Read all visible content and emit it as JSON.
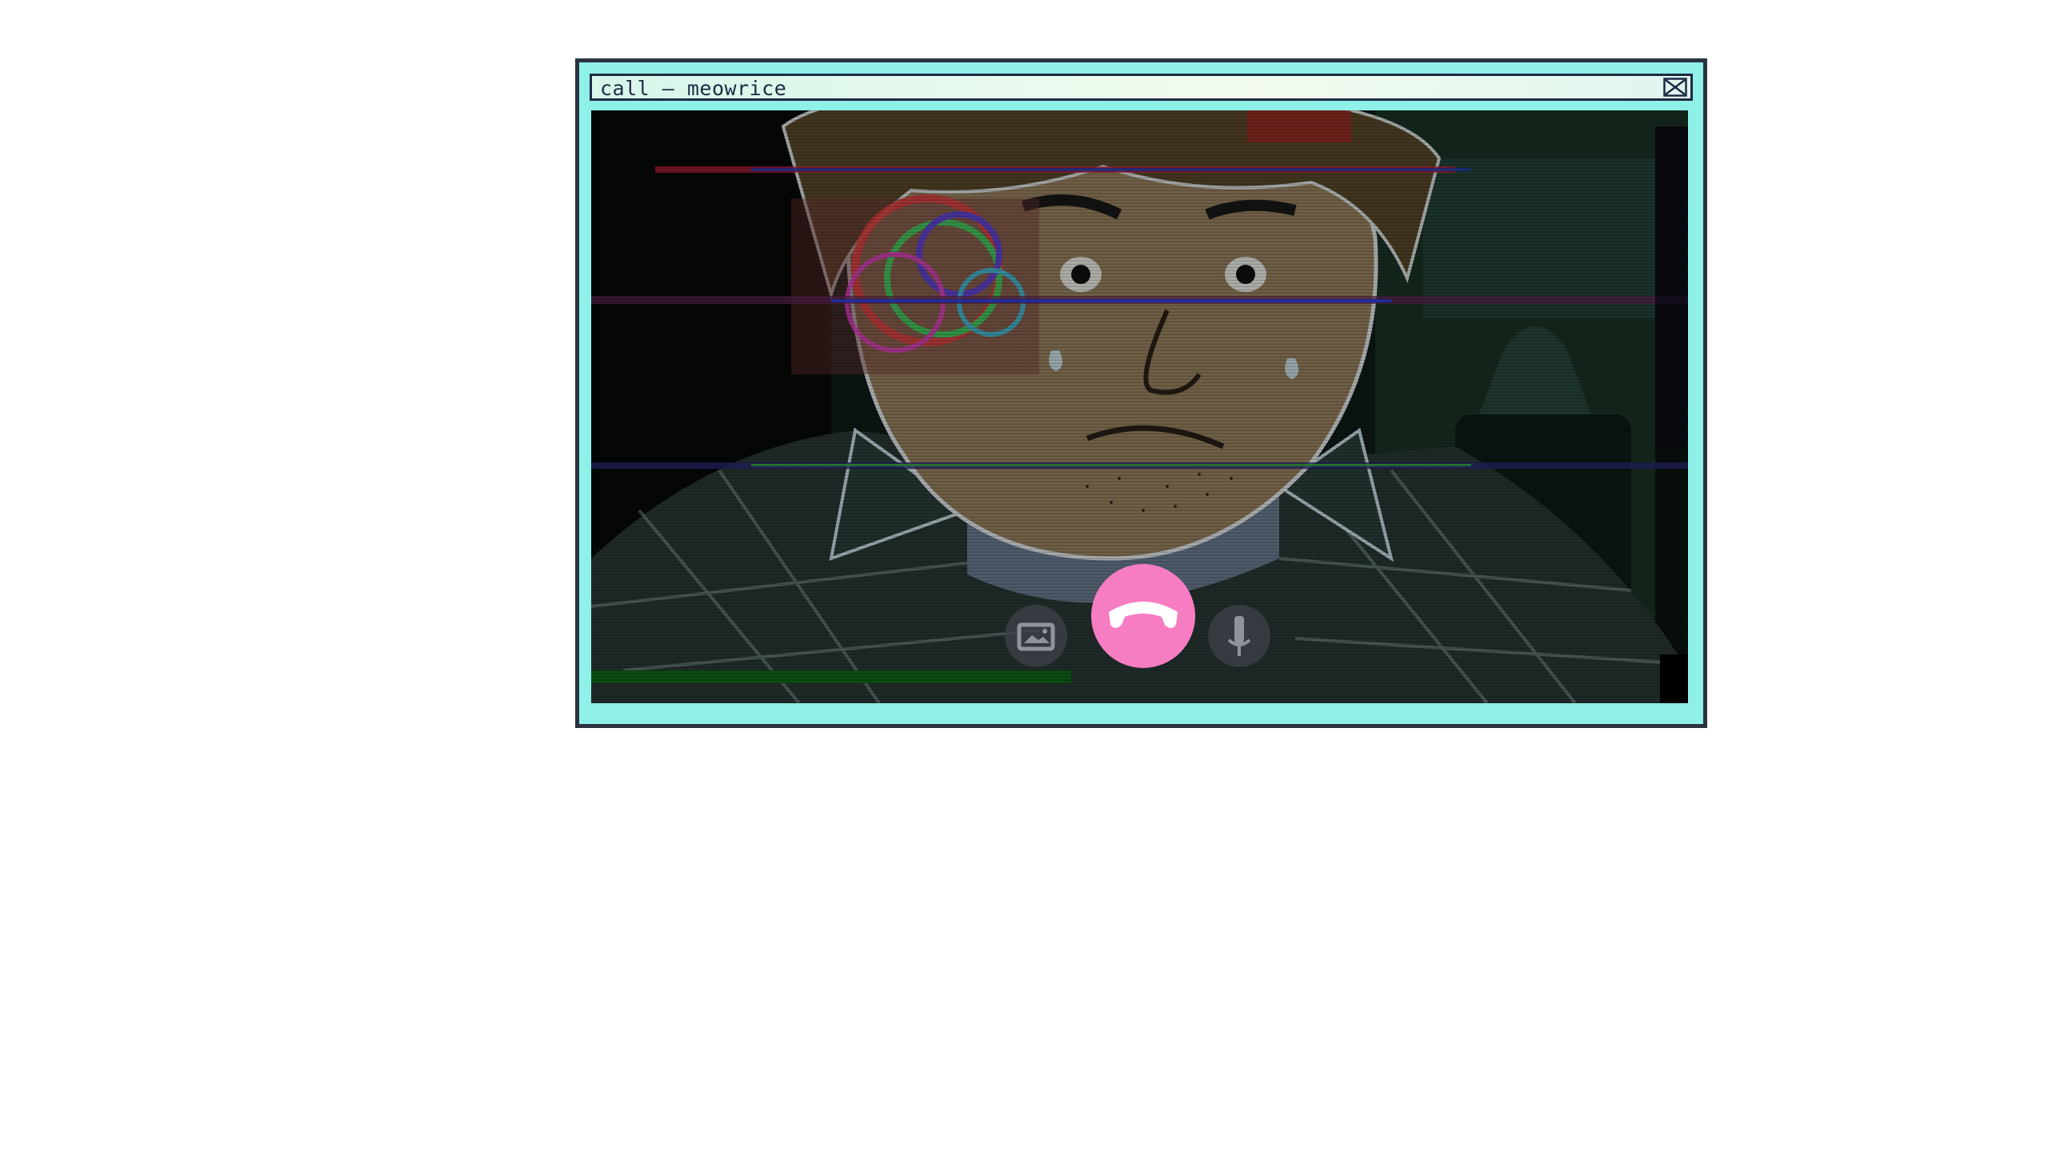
{
  "window": {
    "title": "call – meowrice",
    "close_icon": "close-x-box-icon"
  },
  "call": {
    "controls": [
      {
        "name": "video-toggle",
        "icon": "video-camera-icon"
      },
      {
        "name": "hang-up",
        "icon": "phone-hangup-icon"
      },
      {
        "name": "mute-toggle",
        "icon": "microphone-icon"
      }
    ]
  },
  "colors": {
    "window_border": "#2a3240",
    "window_frame": "#8ff0e8",
    "titlebar": "#e6f8ee",
    "hangup": "#f77dc2",
    "control_bg": "#3c4048"
  }
}
